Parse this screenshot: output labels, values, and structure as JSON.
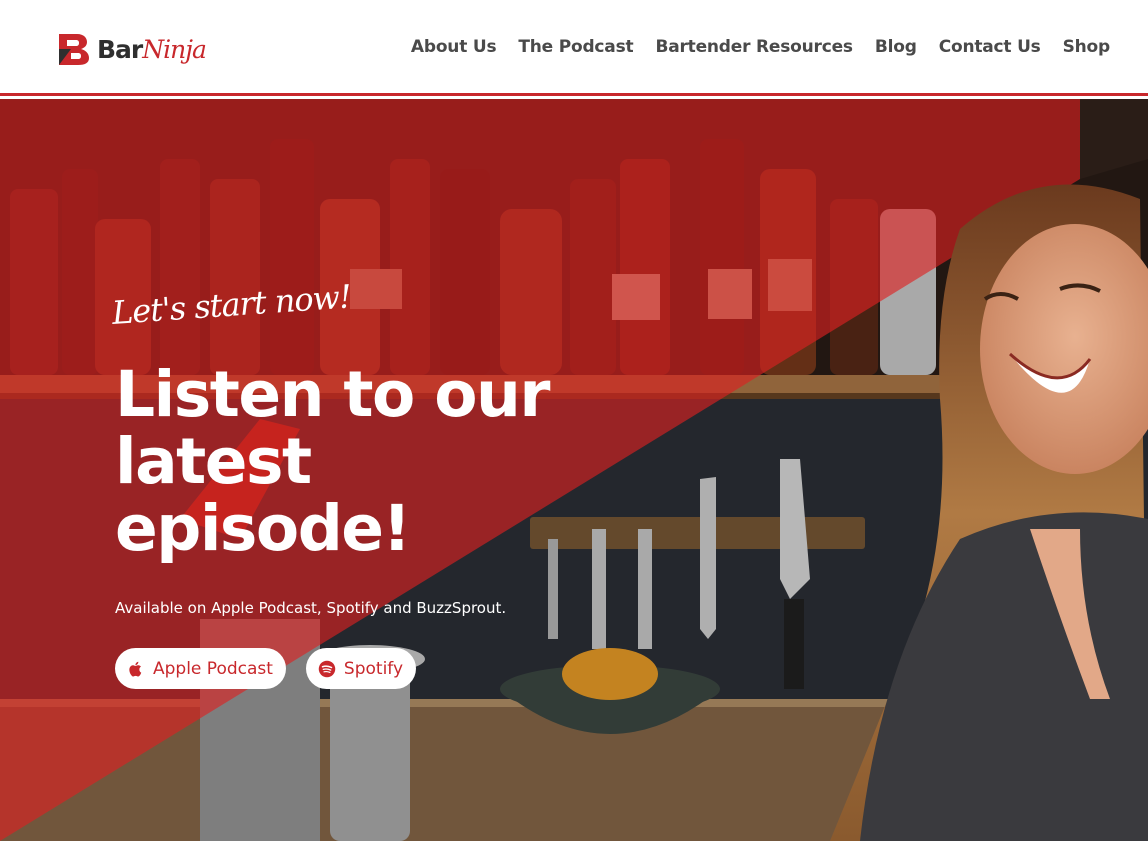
{
  "brand": {
    "name_part1": "Bar",
    "name_part2": "Ninja",
    "accent_color": "#c8282c"
  },
  "nav": {
    "items": [
      {
        "label": "About Us"
      },
      {
        "label": "The Podcast"
      },
      {
        "label": "Bartender Resources"
      },
      {
        "label": "Blog"
      },
      {
        "label": "Contact Us"
      },
      {
        "label": "Shop"
      }
    ]
  },
  "hero": {
    "tagline": "Let's start now!",
    "headline_line1": "Listen to our",
    "headline_line2": "latest",
    "headline_line3": "episode!",
    "subtext": "Available on Apple Podcast, Spotify and BuzzSprout.",
    "buttons": [
      {
        "label": "Apple Podcast",
        "icon": "apple-icon"
      },
      {
        "label": "Spotify",
        "icon": "spotify-icon"
      }
    ]
  }
}
